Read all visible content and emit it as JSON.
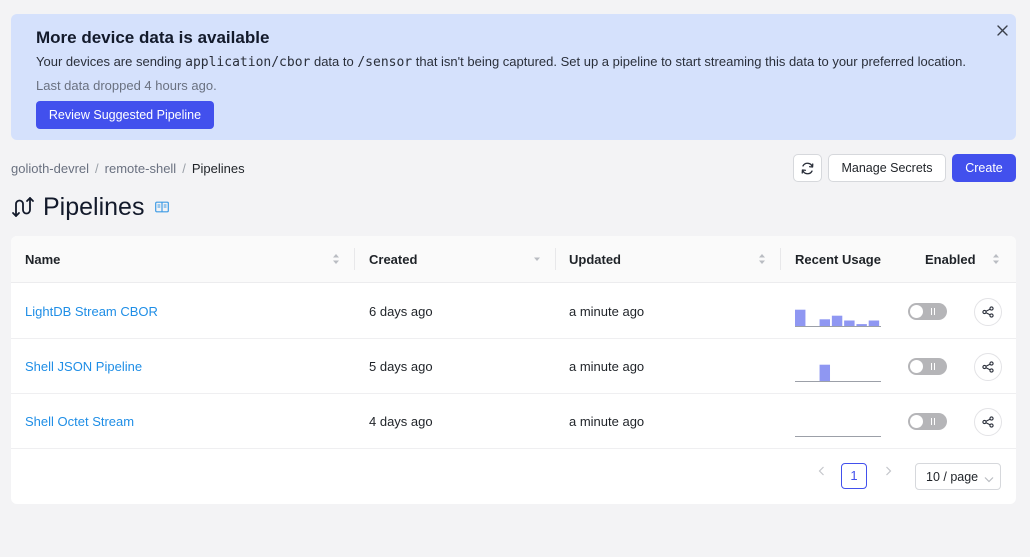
{
  "banner": {
    "title": "More device data is available",
    "body_prefix": "Your devices are sending ",
    "body_content_type": "application/cbor",
    "body_middle": " data to ",
    "body_path": "/sensor",
    "body_suffix": " that isn't being captured. Set up a pipeline to start streaming this data to your preferred location.",
    "last_dropped": "Last data dropped 4 hours ago.",
    "review_button": "Review Suggested Pipeline",
    "close_icon": "close-icon"
  },
  "breadcrumb": {
    "items": [
      "golioth-devrel",
      "remote-shell",
      "Pipelines"
    ],
    "separator": "/"
  },
  "actions": {
    "refresh_icon": "refresh-icon",
    "manage_secrets": "Manage Secrets",
    "create": "Create"
  },
  "page": {
    "title": "Pipelines",
    "title_icon": "pipelines-icon",
    "docs_icon": "book-icon"
  },
  "table": {
    "columns": {
      "name": "Name",
      "created": "Created",
      "updated": "Updated",
      "recent_usage": "Recent Usage",
      "enabled": "Enabled"
    },
    "rows": [
      {
        "name": "LightDB Stream CBOR",
        "created": "6 days ago",
        "updated": "a minute ago",
        "usage": [
          0.7,
          0,
          0.3,
          0.45,
          0.25,
          0.1,
          0.25
        ],
        "enabled": false
      },
      {
        "name": "Shell JSON Pipeline",
        "created": "5 days ago",
        "updated": "a minute ago",
        "usage": [
          0,
          0,
          0.7,
          0,
          0,
          0,
          0
        ],
        "enabled": false
      },
      {
        "name": "Shell Octet Stream",
        "created": "4 days ago",
        "updated": "a minute ago",
        "usage": [
          0,
          0,
          0,
          0,
          0,
          0,
          0
        ],
        "enabled": false
      }
    ]
  },
  "pagination": {
    "current_page": "1",
    "page_size": "10 / page"
  },
  "colors": {
    "accent": "#4250ed",
    "banner_bg": "#d5e1fc",
    "link": "#1f8ee6",
    "usage_bar": "#8f97f2",
    "toggle_off": "#b5b5b8"
  }
}
